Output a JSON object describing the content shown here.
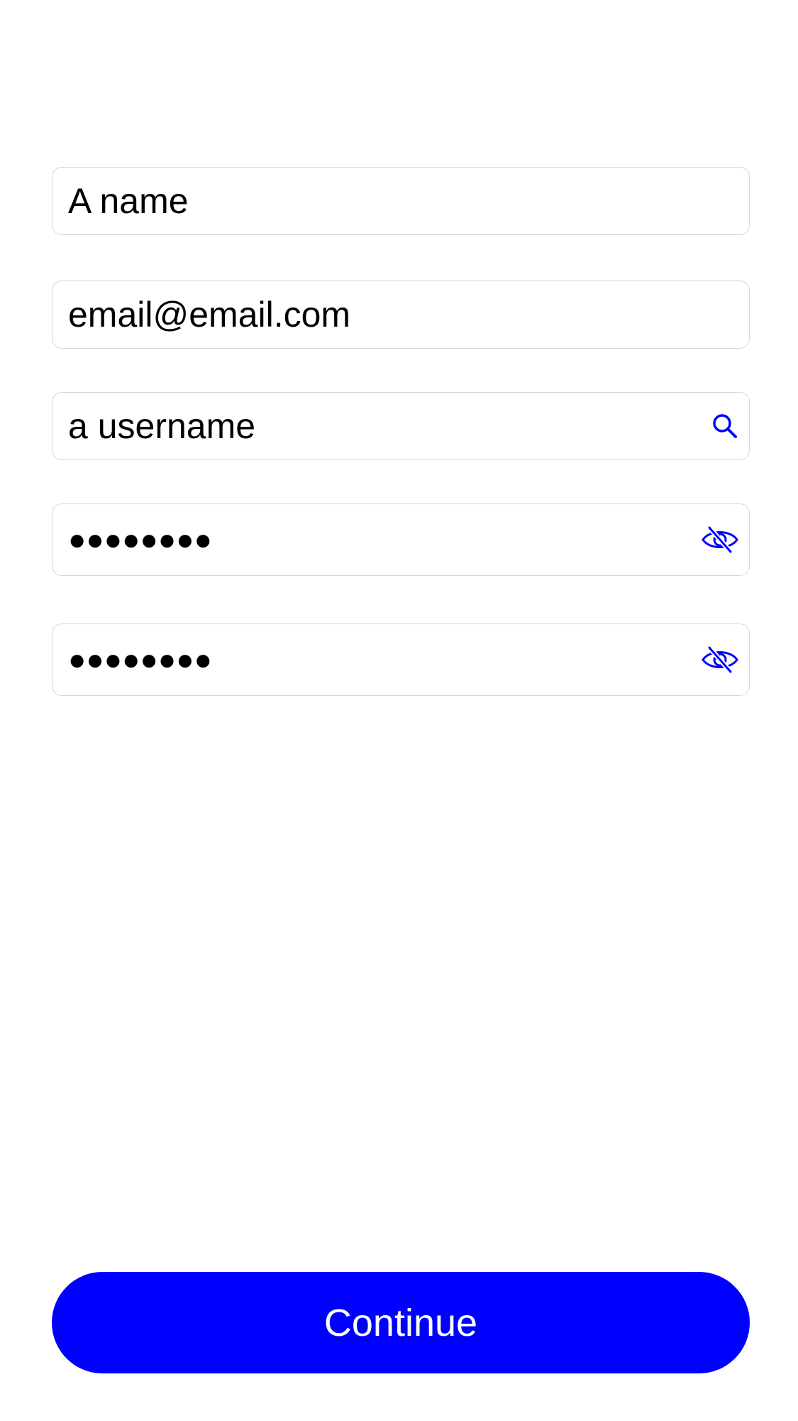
{
  "form": {
    "name": {
      "value": "A name"
    },
    "email": {
      "value": "email@email.com"
    },
    "username": {
      "value": "a username",
      "icon": "search-icon"
    },
    "password": {
      "value": "●●●●●●●●",
      "icon": "eye-slash-icon"
    },
    "confirm_password": {
      "value": "●●●●●●●●",
      "icon": "eye-slash-icon"
    }
  },
  "actions": {
    "continue_label": "Continue"
  },
  "colors": {
    "accent": "#0000FF",
    "field_border": "#D6D6D6",
    "text": "#000000",
    "background": "#FFFFFF"
  }
}
